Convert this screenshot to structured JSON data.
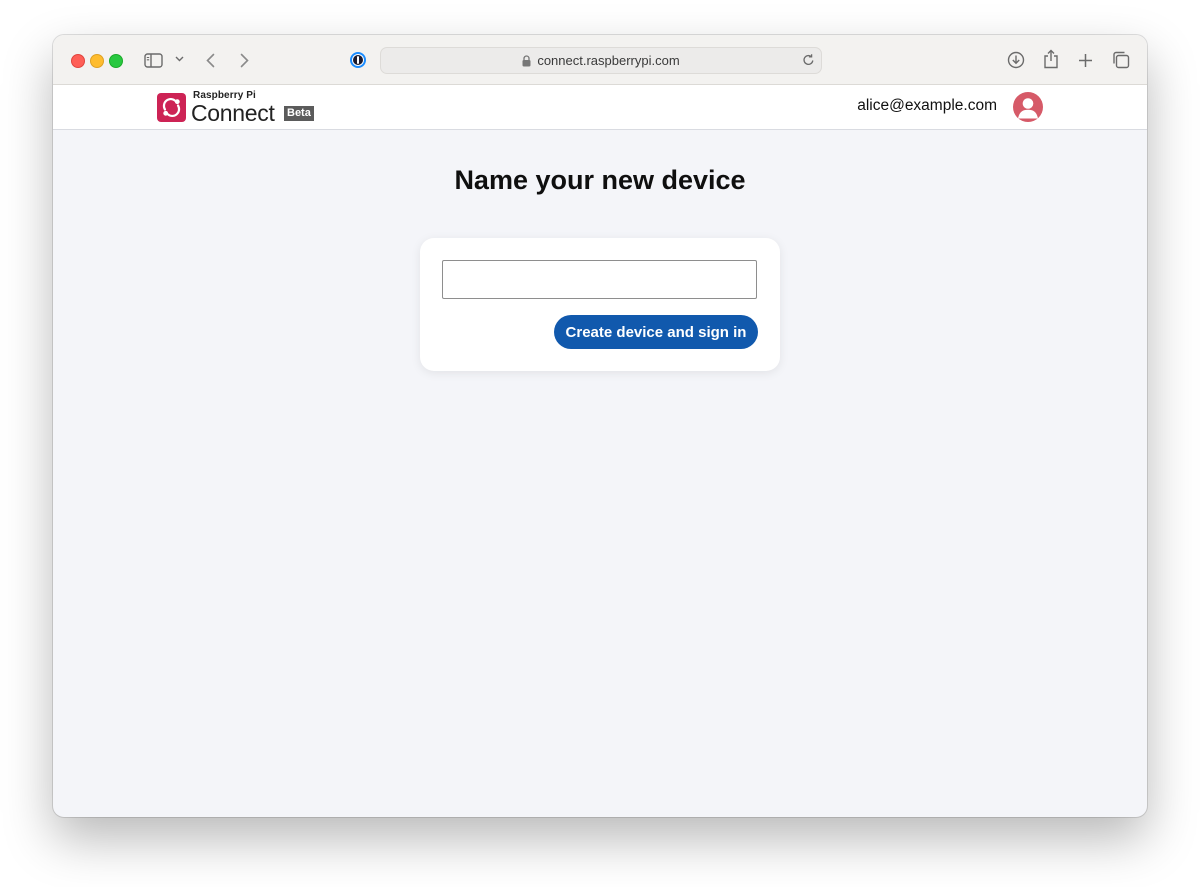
{
  "browser": {
    "url": "connect.raspberrypi.com",
    "icons": {
      "sidebar": "sidebar-icon",
      "sidebar_menu": "chevron-down-icon",
      "back": "chevron-left-icon",
      "forward": "chevron-right-icon",
      "password_manager": "1password-icon",
      "lock": "lock-icon",
      "reload": "reload-icon",
      "downloads": "download-icon",
      "share": "share-icon",
      "new_tab": "plus-icon",
      "tabs_overview": "tabs-icon"
    }
  },
  "header": {
    "brand_small": "Raspberry Pi",
    "brand_name": "Connect",
    "badge": "Beta",
    "user_email": "alice@example.com",
    "colors": {
      "logo": "#cd2355",
      "avatar": "#d65a68",
      "badge": "#5b5b5b"
    }
  },
  "main": {
    "title": "Name your new device",
    "device_name_value": "",
    "device_name_placeholder": "",
    "submit_label": "Create device and sign in",
    "colors": {
      "button": "#1159ad",
      "background": "#f4f5f9"
    }
  }
}
